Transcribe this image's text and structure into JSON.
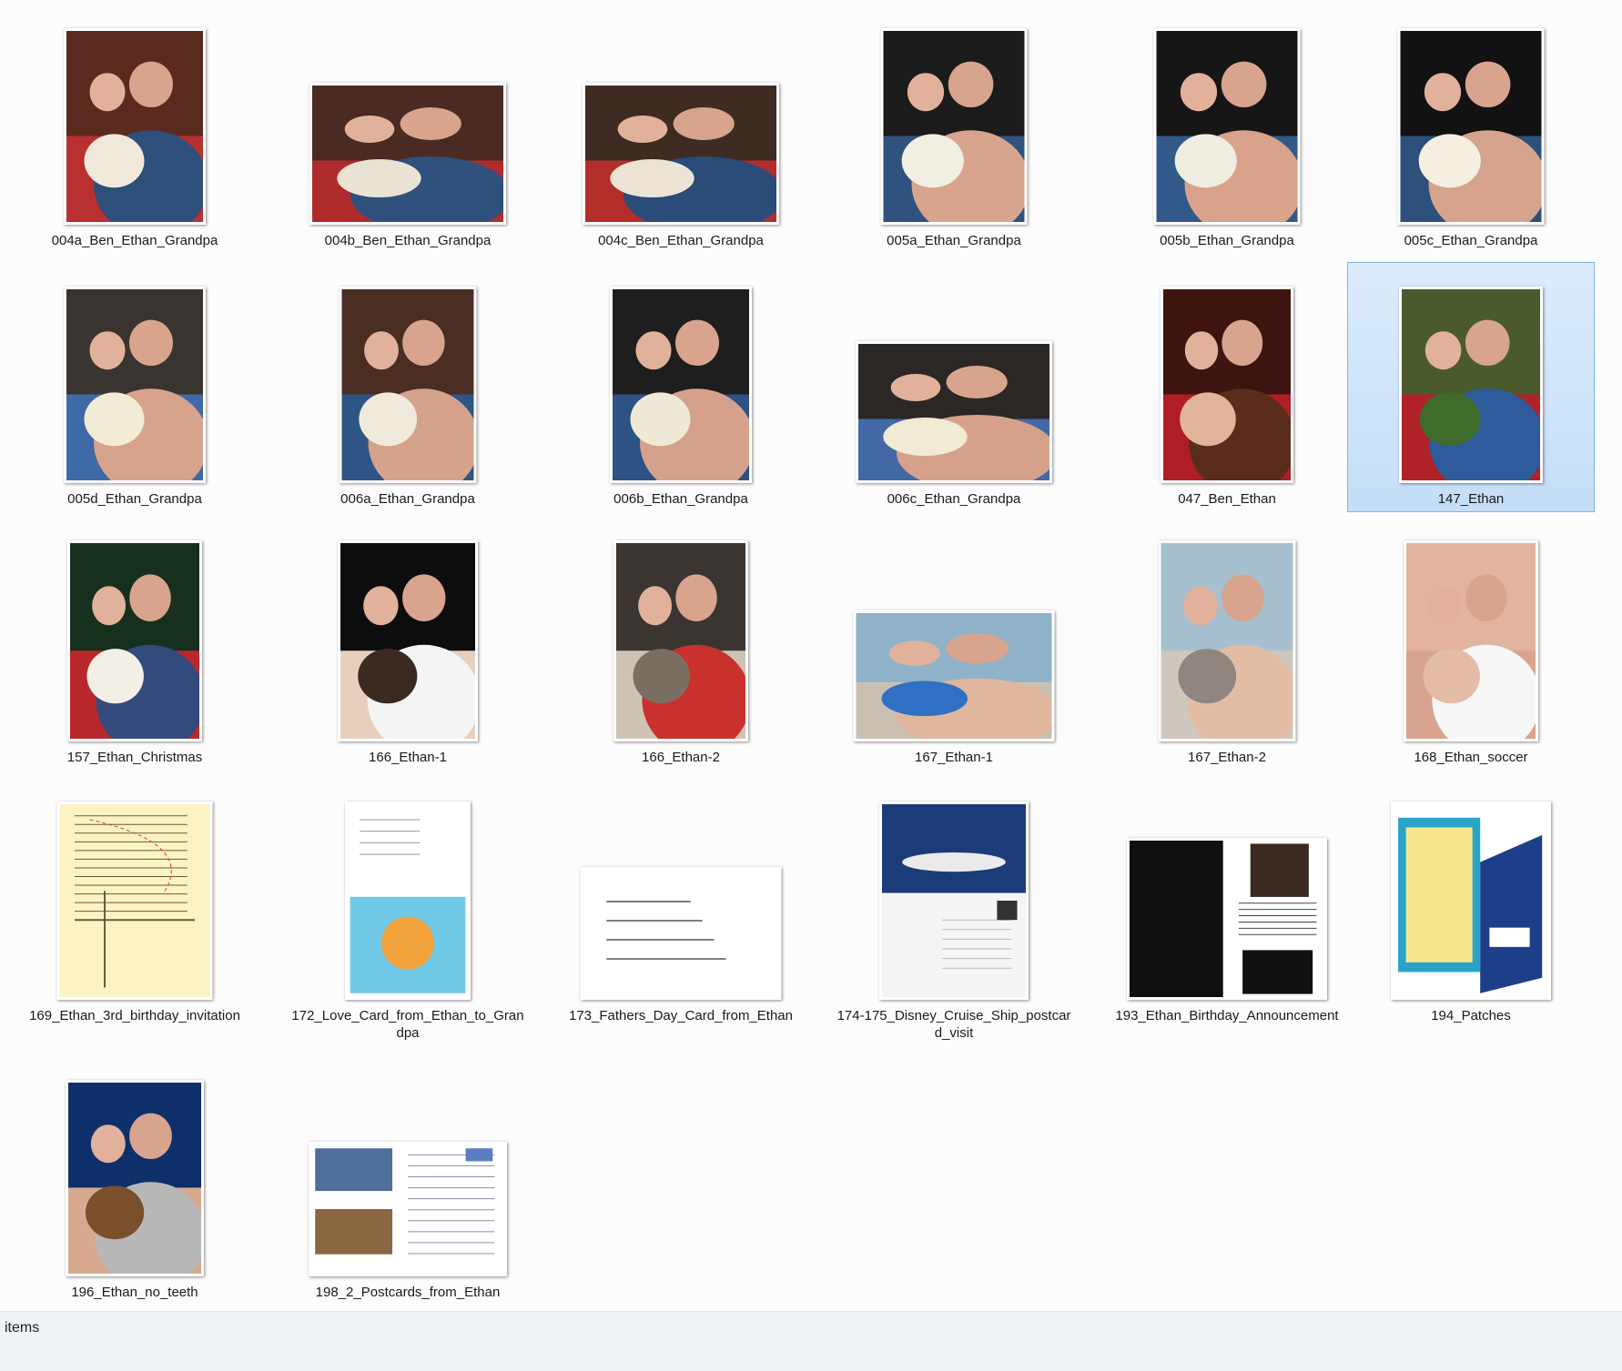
{
  "status": {
    "text": "items"
  },
  "files": [
    {
      "name": "004a_Ben_Ethan_Grandpa",
      "selected": false,
      "kind": "photo-portrait",
      "palette": [
        "#5b2a1f",
        "#b8302f",
        "#2d4f7a",
        "#f1e9dc"
      ]
    },
    {
      "name": "004b_Ben_Ethan_Grandpa",
      "selected": false,
      "kind": "photo-landscape",
      "palette": [
        "#4a2a22",
        "#b02c2c",
        "#2f4f7d",
        "#eae2d3"
      ]
    },
    {
      "name": "004c_Ben_Ethan_Grandpa",
      "selected": false,
      "kind": "photo-landscape",
      "palette": [
        "#3e2b22",
        "#b32d2b",
        "#2b4b78",
        "#ede4d6"
      ]
    },
    {
      "name": "005a_Ethan_Grandpa",
      "selected": false,
      "kind": "photo-portrait",
      "palette": [
        "#1b1b1b",
        "#2f527f",
        "#d9a48e",
        "#f1eee2"
      ]
    },
    {
      "name": "005b_Ethan_Grandpa",
      "selected": false,
      "kind": "photo-portrait",
      "palette": [
        "#161616",
        "#31598a",
        "#d8a28b",
        "#efede1"
      ]
    },
    {
      "name": "005c_Ethan_Grandpa",
      "selected": false,
      "kind": "photo-portrait",
      "palette": [
        "#121212",
        "#2c4f7c",
        "#d6a48d",
        "#f4efe0"
      ]
    },
    {
      "name": "005d_Ethan_Grandpa",
      "selected": false,
      "kind": "photo-portrait",
      "palette": [
        "#3a3430",
        "#3f6aa6",
        "#d7a38c",
        "#f2ecd6"
      ]
    },
    {
      "name": "006a_Ethan_Grandpa",
      "selected": false,
      "kind": "photo-portrait",
      "palette": [
        "#4a2e24",
        "#2e5585",
        "#d5a28b",
        "#efeadb"
      ]
    },
    {
      "name": "006b_Ethan_Grandpa",
      "selected": false,
      "kind": "photo-portrait",
      "palette": [
        "#1e1e1e",
        "#2d5283",
        "#d6a18a",
        "#efe9d8"
      ]
    },
    {
      "name": "006c_Ethan_Grandpa",
      "selected": false,
      "kind": "photo-landscape",
      "palette": [
        "#2b2724",
        "#4268a6",
        "#d6a18b",
        "#f1ebd5"
      ]
    },
    {
      "name": "047_Ben_Ethan",
      "selected": false,
      "kind": "photo-portrait",
      "palette": [
        "#3d1410",
        "#b01e25",
        "#5a2c1c",
        "#e2b49a"
      ]
    },
    {
      "name": "147_Ethan",
      "selected": true,
      "kind": "photo-portrait",
      "palette": [
        "#4a5a2c",
        "#b02128",
        "#2e5b9c",
        "#3f6b2d"
      ]
    },
    {
      "name": "157_Ethan_Christmas",
      "selected": false,
      "kind": "photo-portrait",
      "palette": [
        "#16301d",
        "#b8282b",
        "#324a7c",
        "#f3efe6"
      ]
    },
    {
      "name": "166_Ethan-1",
      "selected": false,
      "kind": "photo-portrait",
      "palette": [
        "#0d0d0d",
        "#e6d0bd",
        "#f4f4f4",
        "#3a2a22"
      ]
    },
    {
      "name": "166_Ethan-2",
      "selected": false,
      "kind": "photo-portrait",
      "palette": [
        "#3b3532",
        "#cfc4b4",
        "#c9312d",
        "#7a6e62"
      ]
    },
    {
      "name": "167_Ethan-1",
      "selected": false,
      "kind": "photo-landscape",
      "palette": [
        "#8fb2c8",
        "#c9c0b3",
        "#e0b79d",
        "#2f6fc4"
      ]
    },
    {
      "name": "167_Ethan-2",
      "selected": false,
      "kind": "photo-portrait",
      "palette": [
        "#a7c0d0",
        "#cfc7bd",
        "#e2bda4",
        "#8f877f"
      ]
    },
    {
      "name": "168_Ethan_soccer",
      "selected": false,
      "kind": "photo-portrait",
      "palette": [
        "#e2b39f",
        "#d9a48f",
        "#f7f7f7",
        "#e5bca6"
      ]
    },
    {
      "name": "169_Ethan_3rd_birthday_invitation",
      "selected": false,
      "kind": "doc-map",
      "palette": [
        "#fbf3c4",
        "#c74638",
        "#6a5a3a",
        "#f5e7a6"
      ]
    },
    {
      "name": "172_Love_Card_from_Ethan_to_Grandpa",
      "selected": false,
      "kind": "doc-card",
      "palette": [
        "#ffffff",
        "#6fc9e6",
        "#f2a23a",
        "#c23a7a"
      ]
    },
    {
      "name": "173_Fathers_Day_Card_from_Ethan",
      "selected": false,
      "kind": "doc-note",
      "palette": [
        "#ffffff",
        "#555555",
        "#777777",
        "#999999"
      ]
    },
    {
      "name": "174-175_Disney_Cruise_Ship_postcard_visit",
      "selected": false,
      "kind": "doc-postcard",
      "palette": [
        "#1b3c78",
        "#f5f5f5",
        "#3c5c9c",
        "#b7b7b7"
      ]
    },
    {
      "name": "193_Ethan_Birthday_Announcement",
      "selected": false,
      "kind": "doc-announce",
      "palette": [
        "#101010",
        "#ffffff",
        "#2a3b70",
        "#c22a2a"
      ]
    },
    {
      "name": "194_Patches",
      "selected": false,
      "kind": "doc-patch",
      "palette": [
        "#ffffff",
        "#2aa3c9",
        "#1d3f8a",
        "#f0c13a"
      ]
    },
    {
      "name": "196_Ethan_no_teeth",
      "selected": false,
      "kind": "photo-portrait",
      "palette": [
        "#0e2f6a",
        "#d8a98f",
        "#b8b8b8",
        "#7a4f2c"
      ]
    },
    {
      "name": "198_2_Postcards_from_Ethan",
      "selected": false,
      "kind": "doc-postcards",
      "palette": [
        "#ffffff",
        "#4e6f9a",
        "#8a6642",
        "#c43030"
      ]
    }
  ]
}
